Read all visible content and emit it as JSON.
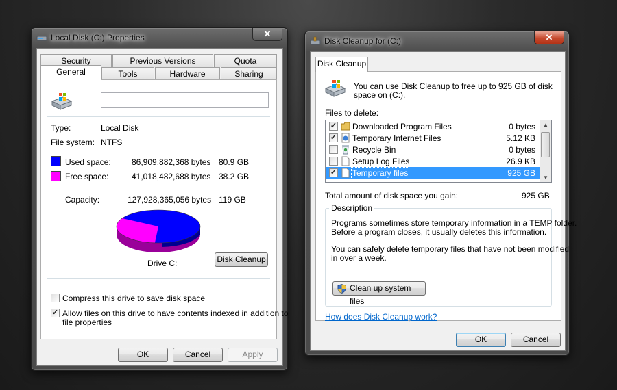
{
  "props": {
    "title": "Local Disk (C:) Properties",
    "close": "✕",
    "tabs_top": [
      "Security",
      "Previous Versions",
      "Quota"
    ],
    "tabs_bottom": [
      "General",
      "Tools",
      "Hardware",
      "Sharing"
    ],
    "name_value": "",
    "type_label": "Type:",
    "type_value": "Local Disk",
    "fs_label": "File system:",
    "fs_value": "NTFS",
    "used_label": "Used space:",
    "used_bytes": "86,909,882,368 bytes",
    "used_gb": "80.9 GB",
    "free_label": "Free space:",
    "free_bytes": "41,018,482,688 bytes",
    "free_gb": "38.2 GB",
    "cap_label": "Capacity:",
    "cap_bytes": "127,928,365,056 bytes",
    "cap_gb": "119 GB",
    "drive_label": "Drive C:",
    "cleanup_button": "Disk Cleanup",
    "compress_label": "Compress this drive to save disk space",
    "index_label_1": "Allow files on this drive to have contents indexed in addition to",
    "index_label_2": "file properties",
    "ok": "OK",
    "cancel": "Cancel",
    "apply": "Apply",
    "used_fraction": 0.68,
    "colors": {
      "used": "#0000ff",
      "free": "#ff00ff"
    }
  },
  "cleanup": {
    "title": "Disk Cleanup for  (C:)",
    "close": "✕",
    "tab": "Disk Cleanup",
    "intro_1": "You can use Disk Cleanup to free up to 925 GB of disk",
    "intro_2": "space on  (C:).",
    "files_label": "Files to delete:",
    "files": [
      {
        "name": "Downloaded Program Files",
        "size": "0 bytes",
        "checked": true,
        "icon": "folder-icon"
      },
      {
        "name": "Temporary Internet Files",
        "size": "5.12 KB",
        "checked": true,
        "icon": "internet-files-icon"
      },
      {
        "name": "Recycle Bin",
        "size": "0 bytes",
        "checked": false,
        "icon": "recycle-bin-icon"
      },
      {
        "name": "Setup Log Files",
        "size": "26.9 KB",
        "checked": false,
        "icon": "document-icon"
      },
      {
        "name": "Temporary files",
        "size": "925 GB",
        "checked": true,
        "icon": "document-icon",
        "selected": true
      }
    ],
    "total_label": "Total amount of disk space you gain:",
    "total_value": "925 GB",
    "desc_title": "Description",
    "desc_1": "Programs sometimes store temporary information in a TEMP folder.",
    "desc_2": "Before a program closes, it usually deletes this information.",
    "desc_3": "You can safely delete temporary files that have not been modified",
    "desc_4": "in over a week.",
    "system_button": "Clean up system files",
    "help_link": "How does Disk Cleanup work?",
    "ok": "OK",
    "cancel": "Cancel"
  }
}
